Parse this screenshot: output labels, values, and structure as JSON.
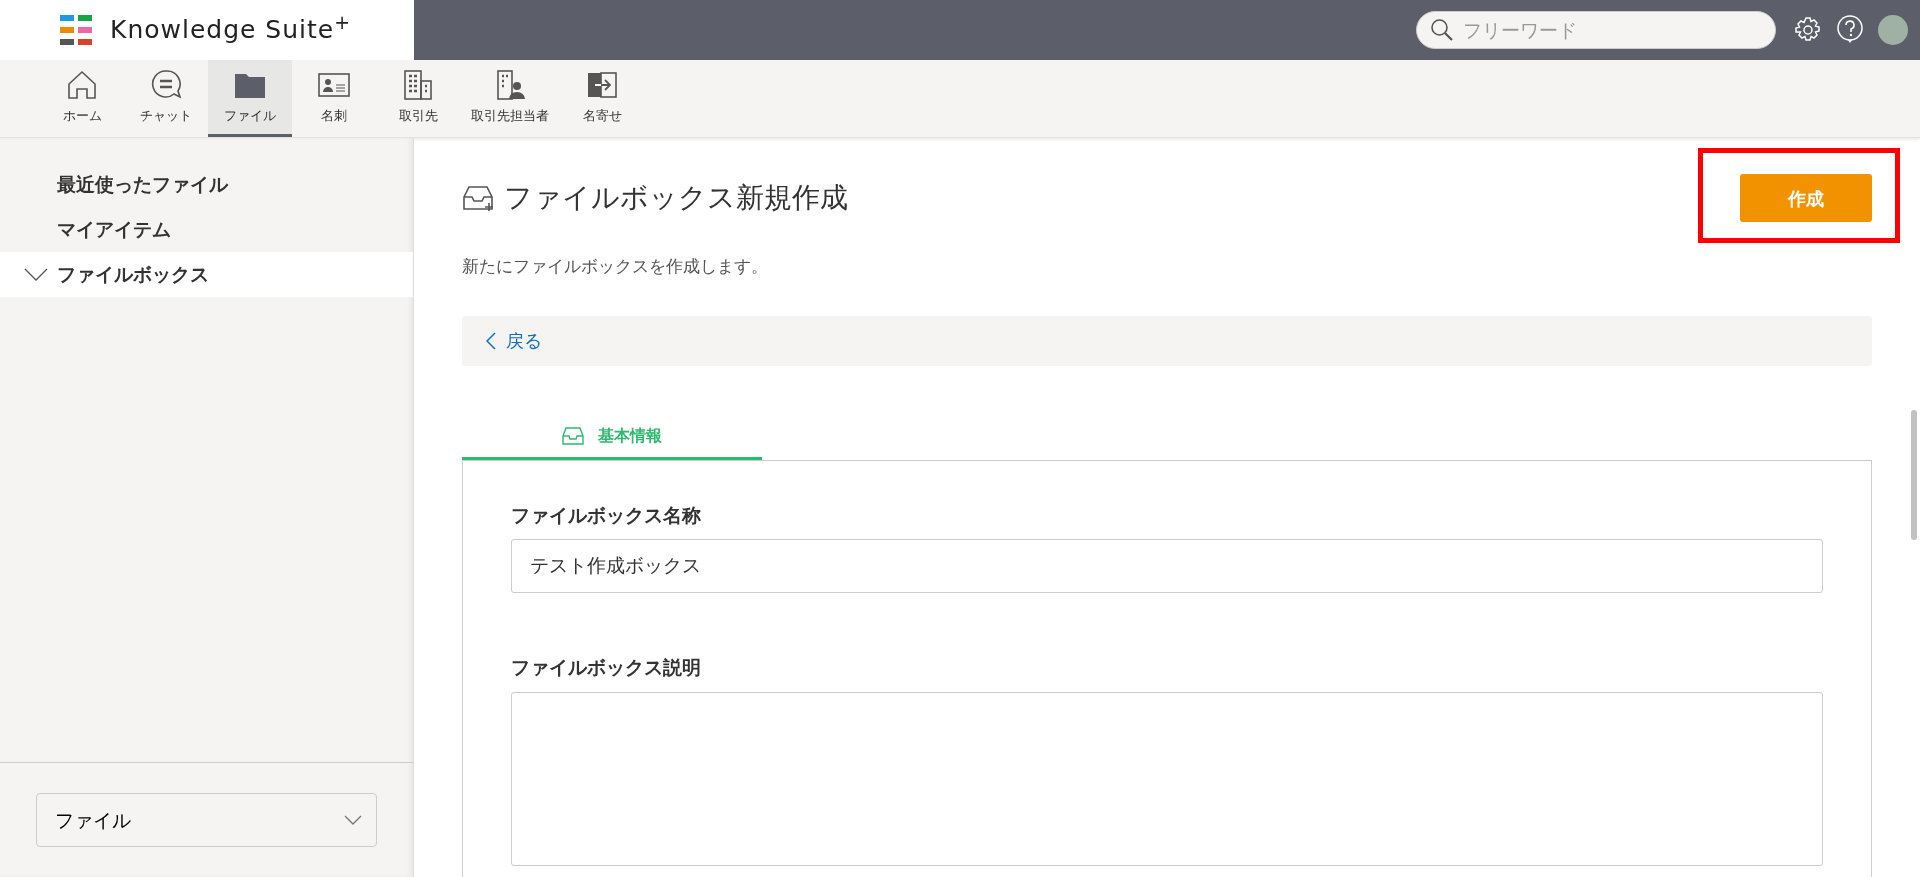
{
  "header": {
    "logo": "Knowledge Suite",
    "logo_mark": "+",
    "search": {
      "placeholder": "フリーワード"
    }
  },
  "toolbar": [
    {
      "label": "ホーム",
      "kind": "home",
      "selected": false
    },
    {
      "label": "チャット",
      "kind": "chat",
      "selected": false
    },
    {
      "label": "ファイル",
      "kind": "folder",
      "selected": true
    },
    {
      "label": "名刺",
      "kind": "card",
      "selected": false
    },
    {
      "label": "取引先",
      "kind": "building",
      "selected": false
    },
    {
      "label": "取引先担当者",
      "kind": "contact",
      "selected": false
    },
    {
      "label": "名寄せ",
      "kind": "merge",
      "selected": false
    }
  ],
  "sidebar": {
    "items": [
      {
        "label": "最近使ったファイル",
        "kind": "link",
        "selected": false
      },
      {
        "label": "マイアイテム",
        "kind": "link",
        "selected": false
      },
      {
        "label": "ファイルボックス",
        "kind": "group",
        "expanded": true,
        "selected": true
      }
    ],
    "select": {
      "value": "ファイル"
    }
  },
  "page": {
    "title": "ファイルボックス新規作成",
    "create_button": "作成",
    "description": "新たにファイルボックスを作成します。",
    "back_link": "戻る",
    "tabs": [
      {
        "label": "基本情報",
        "selected": true
      }
    ],
    "fields": [
      {
        "label": "ファイルボックス名称",
        "kind": "text",
        "value": "テスト作成ボックス"
      },
      {
        "label": "ファイルボックス説明",
        "kind": "textarea"
      }
    ]
  }
}
